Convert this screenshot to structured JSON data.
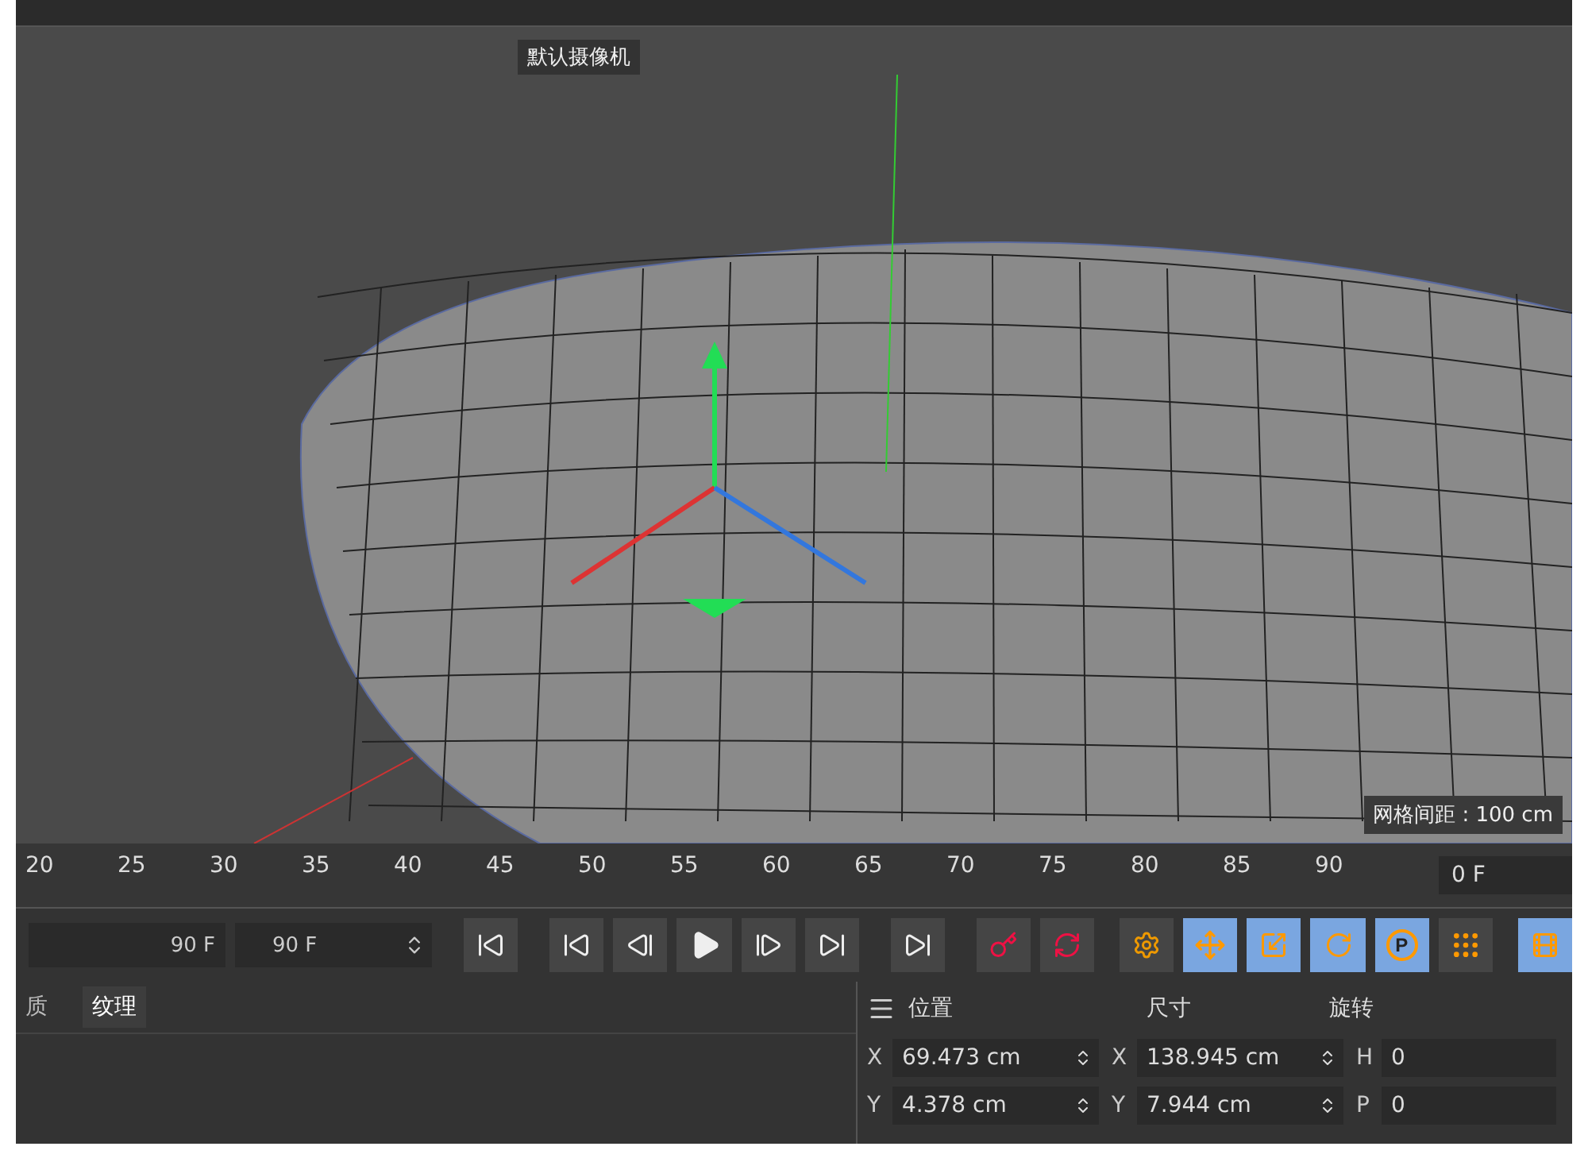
{
  "viewport": {
    "camera_label": "默认摄像机",
    "grid_spacing": "网格间距 : 100 cm"
  },
  "timeline": {
    "ticks": [
      "20",
      "25",
      "30",
      "35",
      "40",
      "45",
      "50",
      "55",
      "60",
      "65",
      "70",
      "75",
      "80",
      "85",
      "90"
    ],
    "current_frame": "0 F"
  },
  "transport": {
    "start_field": "90 F",
    "end_field": "90 F"
  },
  "tools": [
    {
      "kind": "record",
      "selected": false
    },
    {
      "kind": "autokey",
      "selected": false
    },
    {
      "kind": "gear",
      "selected": false
    },
    {
      "kind": "move",
      "selected": true
    },
    {
      "kind": "scale",
      "selected": true
    },
    {
      "kind": "rotate",
      "selected": true
    },
    {
      "kind": "param",
      "label": "P",
      "selected": true
    },
    {
      "kind": "dots",
      "selected": false
    },
    {
      "kind": "film",
      "selected": true
    }
  ],
  "material_tabs": [
    {
      "label": "质",
      "selected": false
    },
    {
      "label": "纹理",
      "selected": true
    }
  ],
  "coords": {
    "headers": [
      "位置",
      "尺寸",
      "旋转"
    ],
    "rows": [
      {
        "axis": "X",
        "position": "69.473 cm",
        "size_axis": "X",
        "size": "138.945 cm",
        "rot_axis": "H",
        "rotation": "0"
      },
      {
        "axis": "Y",
        "position": "4.378 cm",
        "size_axis": "Y",
        "size": "7.944 cm",
        "rot_axis": "P",
        "rotation": "0"
      }
    ]
  }
}
